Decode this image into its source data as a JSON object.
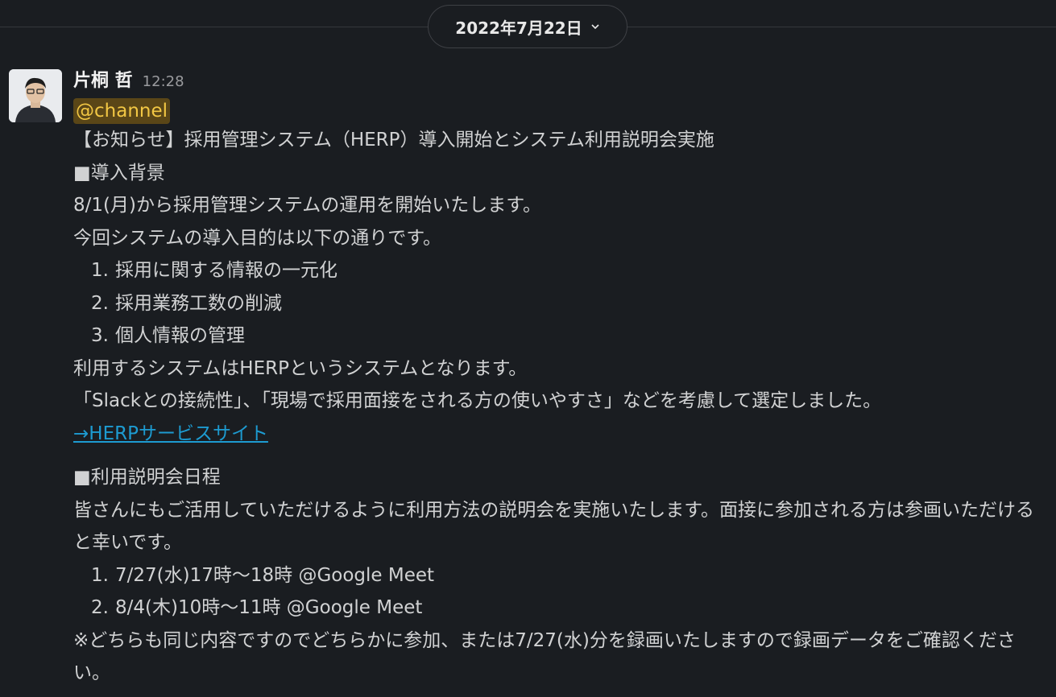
{
  "date_divider": {
    "label": "2022年7月22日"
  },
  "message": {
    "author": "片桐 哲",
    "time": "12:28",
    "mention": "@channel",
    "title": "【お知らせ】採用管理システム（HERP）導入開始とシステム利用説明会実施",
    "section1_heading": "■導入背景",
    "intro_1": "8/1(月)から採用管理システムの運用を開始いたします。",
    "intro_2": "今回システムの導入目的は以下の通りです。",
    "purposes": [
      {
        "num": "1.",
        "text": "採用に関する情報の一元化"
      },
      {
        "num": "2.",
        "text": "採用業務工数の削減"
      },
      {
        "num": "3.",
        "text": "個人情報の管理"
      }
    ],
    "system_line": "利用するシステムはHERPというシステムとなります。",
    "reason_line": "「Slackとの接続性」、「現場で採用面接をされる方の使いやすさ」などを考慮して選定しました。",
    "link_label": "→HERPサービスサイト",
    "section2_heading": "■利用説明会日程",
    "session_intro": "皆さんにもご活用していただけるように利用方法の説明会を実施いたします。面接に参加される方は参画いただけると幸いです。",
    "sessions": [
      {
        "num": "1.",
        "text": "7/27(水)17時〜18時 @Google Meet"
      },
      {
        "num": "2.",
        "text": "8/4(木)10時〜11時 @Google Meet"
      }
    ],
    "note": "※どちらも同じ内容ですのでどちらかに参加、または7/27(水)分を録画いたしますので録画データをご確認ください。"
  }
}
